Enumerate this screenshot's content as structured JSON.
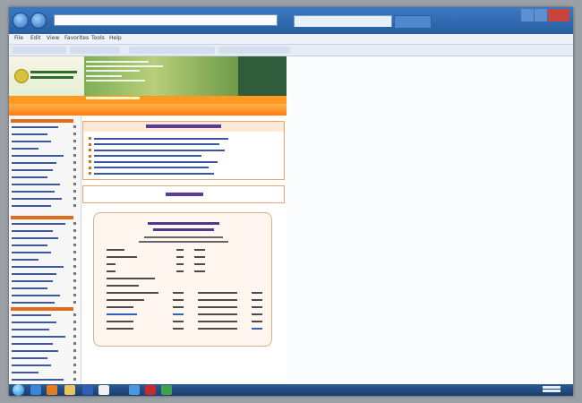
{
  "browser": {
    "address_url": "",
    "active_tab_title": "",
    "menu": {
      "file": "File",
      "edit": "Edit",
      "view": "View",
      "favorites": "Favorites",
      "tools": "Tools",
      "help": "Help"
    }
  },
  "site": {
    "colors": {
      "accent_orange": "#ff8c1a",
      "heading_purple": "#5a3a9a",
      "link_blue": "#3d55a5",
      "banner_green": "#2f5d3b"
    },
    "news_items": 7,
    "stats_rows": 12
  },
  "taskbar": {
    "start_icon": "windows-orb-icon",
    "pinned_icons": [
      "ie-icon",
      "firefox-icon",
      "explorer-icon",
      "word-icon",
      "media-icon",
      "ie-icon",
      "acrobat-icon",
      "app-icon"
    ]
  }
}
